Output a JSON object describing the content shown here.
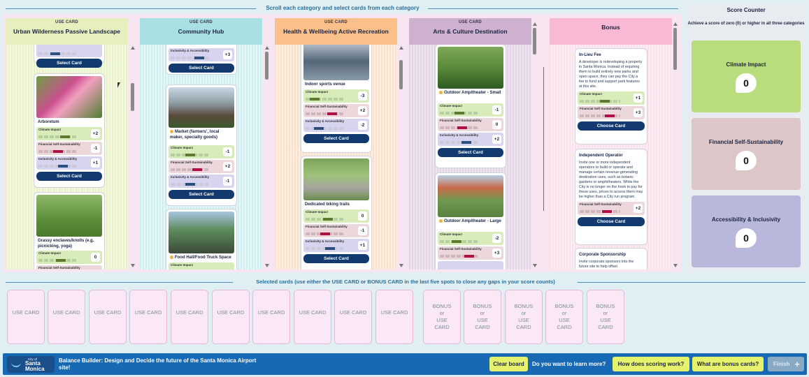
{
  "board": {
    "instruction": "Scroll each category and select cards from each category",
    "columns": [
      {
        "sub": "USE CARD",
        "title": "Urban Wilderness Passive Landscape",
        "select_label": "Select Card",
        "cards": [
          {
            "name": "Arboretum",
            "climate_label": "Climate Impact",
            "climate_score": "+2",
            "financial_label": "Financial Self-Sustainability",
            "financial_score": "-1",
            "access_label": "Inclusivity & Accessibility",
            "access_score": "+1",
            "button": "Select Card"
          },
          {
            "name": "Grassy enclaves/knolls (e.g. picnicking, yoga)",
            "climate_label": "Climate Impact",
            "climate_score": "0",
            "financial_label": "Financial Self-Sustainability"
          }
        ]
      },
      {
        "sub": "USE CARD",
        "title": "Community Hub",
        "top_access_label": "Inclusivity & Accessibility",
        "top_access_score": "+3",
        "select_label": "Select Card",
        "cards": [
          {
            "name": "Market (farmers', local maker, specialty goods)",
            "climate_label": "Climate Impact",
            "climate_score": "-1",
            "financial_label": "Financial Self-Sustainability",
            "financial_score": "+2",
            "access_label": "Inclusivity & Accessibility",
            "access_score": "-1",
            "button": "Select Card"
          },
          {
            "name": "Food Hall/Food Truck Space",
            "climate_label": "Climate Impact"
          }
        ]
      },
      {
        "sub": "USE CARD",
        "title": "Health & Wellbeing Active Recreation",
        "cards": [
          {
            "name": "Indoor sports venue",
            "climate_label": "Climate Impact",
            "climate_score": "-3",
            "financial_label": "Financial Self-Sustainability",
            "financial_score": "+2",
            "access_label": "Inclusivity & Accessibility",
            "access_score": "-2",
            "button": "Select Card"
          },
          {
            "name": "Dedicated biking trails",
            "climate_label": "Climate Impact",
            "climate_score": "0",
            "financial_label": "Financial Self-Sustainability",
            "financial_score": "-1",
            "access_label": "Inclusivity & Accessibility",
            "access_score": "+1",
            "button": "Select Card"
          }
        ]
      },
      {
        "sub": "USE CARD",
        "title": "Arts & Culture Destination",
        "cards": [
          {
            "name": "Outdoor Ampitheater - Small",
            "climate_label": "Climate Impact",
            "climate_score": "-1",
            "financial_label": "Financial Self-Sustainability",
            "financial_score": "0",
            "access_label": "Inclusivity & Accessibility",
            "access_score": "+2",
            "button": "Select Card"
          },
          {
            "name": "Outdoor Ampitheater - Large",
            "climate_label": "Climate Impact",
            "climate_score": "-2",
            "financial_label": "Financial Self-Sustainability",
            "financial_score": "+3"
          }
        ]
      },
      {
        "sub": "",
        "title": "Bonus",
        "cards": [
          {
            "name": "In-Lieu Fee",
            "desc": "A developer is redeveloping a property in Santa Monica. Instead of requiring them to build entirely new parks and open space, they can pay the City a fee to fund and support park features at this site.",
            "climate_label": "Climate Impact",
            "climate_score": "+1",
            "financial_label": "Financial Self-Sustainability",
            "financial_score": "+3",
            "button": "Choose Card"
          },
          {
            "name": "Independent Operator",
            "desc": "Invite one or more independent operators to build or operate and manage certain revenue-generating destination uses, such as botanic gardens or amphitheaters. While the City is no longer on the hook to pay for these uses, prices to access them may be higher than a City run program.",
            "financial_label": "Financial Self-Sustainability",
            "financial_score": "+2",
            "button": "Choose Card"
          },
          {
            "name": "Corporate Sponsorship",
            "desc": "Invite corporate sponsors into the future site to help offset"
          }
        ]
      }
    ]
  },
  "score_counter": {
    "title": "Score Counter",
    "subtitle": "Achieve a score of zero (0) or higher in all three categories",
    "counters": [
      {
        "label": "Climate Impact",
        "value": "0",
        "color": "#b9dc7c"
      },
      {
        "label": "Financial Self-Sustainability",
        "value": "0",
        "color": "#dcc6c8"
      },
      {
        "label": "Accessibility & Inclusivity",
        "value": "0",
        "color": "#b9b7dc"
      }
    ]
  },
  "selected": {
    "instruction": "Selected cards (use either the USE CARD or BONUS CARD in the last five spots to close any gaps in your score counts)",
    "use_slots": [
      "USE CARD",
      "USE CARD",
      "USE CARD",
      "USE CARD",
      "USE CARD",
      "USE CARD",
      "USE CARD",
      "USE CARD",
      "USE CARD",
      "USE CARD"
    ],
    "bonus_line1": "BONUS",
    "bonus_line2": "or",
    "bonus_line3": "USE",
    "bonus_line4": "CARD"
  },
  "footer": {
    "logo_city": "City of",
    "logo_name1": "Santa",
    "logo_name2": "Monica",
    "title": "Balance Builder: Design and Decide the future of the Santa Monica Airport site!",
    "clear": "Clear board",
    "learn": "Do you want to learn more?",
    "scoring": "How does scoring work?",
    "bonus": "What are bonus cards?",
    "finish": "Finish",
    "finish_icon": "+"
  }
}
